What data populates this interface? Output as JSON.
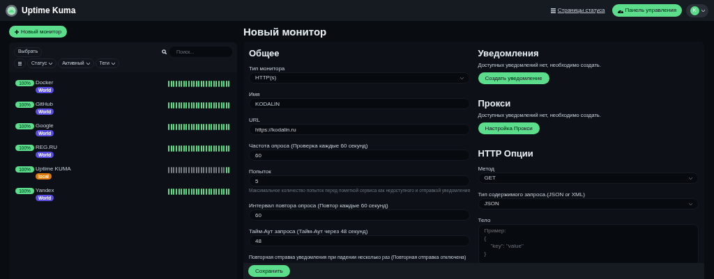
{
  "header": {
    "brand": "Uptime Kuma",
    "status_pages": "Страницы статуса",
    "dashboard": "Панель управления",
    "avatar": "K"
  },
  "sidebar": {
    "new_monitor": "Новый монитор",
    "select": "Выбрать",
    "search": {
      "placeholder": "Поиск..."
    },
    "filters": [
      {
        "label": "Статус"
      },
      {
        "label": "Активный"
      },
      {
        "label": "Теги"
      }
    ],
    "monitors": [
      {
        "uptime": "100%",
        "name": "Docker",
        "tag": {
          "label": "World",
          "color": "#5a4ee6"
        },
        "beats": [
          true,
          true,
          true,
          true,
          true,
          true,
          true,
          true,
          true,
          true,
          true,
          true,
          true,
          true,
          true,
          true,
          true,
          true,
          true,
          true,
          true,
          true,
          true,
          true,
          true
        ]
      },
      {
        "uptime": "100%",
        "name": "GitHub",
        "tag": {
          "label": "World",
          "color": "#5a4ee6"
        },
        "beats": [
          true,
          true,
          true,
          true,
          true,
          true,
          true,
          true,
          true,
          true,
          true,
          true,
          true,
          true,
          true,
          true,
          true,
          true,
          true,
          true,
          true,
          true,
          true,
          true,
          true
        ]
      },
      {
        "uptime": "100%",
        "name": "Google",
        "tag": {
          "label": "World",
          "color": "#5a4ee6"
        },
        "beats": [
          true,
          true,
          true,
          true,
          true,
          true,
          true,
          true,
          true,
          true,
          true,
          true,
          true,
          true,
          true,
          true,
          true,
          true,
          true,
          true,
          true,
          true,
          true,
          true,
          true
        ]
      },
      {
        "uptime": "100%",
        "name": "REG.RU",
        "tag": {
          "label": "World",
          "color": "#5a4ee6"
        },
        "beats": [
          true,
          true,
          true,
          true,
          true,
          true,
          true,
          true,
          true,
          true,
          true,
          true,
          true,
          true,
          true,
          true,
          true,
          true,
          true,
          true,
          true,
          true,
          true,
          true,
          true
        ]
      },
      {
        "uptime": "100%",
        "name": "Uptime KUMA",
        "tag": {
          "label": "local",
          "color": "#e07b0a"
        },
        "beats": [
          false,
          false,
          false,
          false,
          false,
          false,
          false,
          false,
          false,
          false,
          false,
          false,
          false,
          false,
          false,
          false,
          false,
          false,
          false,
          false,
          false,
          false,
          false,
          true,
          true
        ]
      },
      {
        "uptime": "100%",
        "name": "Yandex",
        "tag": {
          "label": "World",
          "color": "#5a4ee6"
        },
        "beats": [
          true,
          true,
          true,
          true,
          true,
          true,
          true,
          true,
          true,
          true,
          true,
          true,
          true,
          true,
          true,
          true,
          true,
          true,
          true,
          true,
          true,
          true,
          true,
          true,
          true
        ]
      }
    ]
  },
  "page_title": "Новый монитор",
  "general": {
    "title": "Общее",
    "fields": [
      {
        "kind": "select",
        "label": "Тип монитора",
        "value": "HTTP(s)"
      },
      {
        "kind": "input",
        "label": "Имя",
        "value": "KODALIN"
      },
      {
        "kind": "input",
        "label": "URL",
        "value": "https://kodalin.ru"
      },
      {
        "kind": "input",
        "label": "Частота опроса (Проверка каждые 60 секунд)",
        "value": "60"
      },
      {
        "kind": "input",
        "label": "Попыток",
        "value": "5",
        "hint": "Максимальное количество попыток перед пометкой сервиса как недоступного и отправкой уведомления"
      },
      {
        "kind": "input",
        "label": "Интервал повтора опроса (Повтор каждые 60 секунд)",
        "value": "60"
      },
      {
        "kind": "input",
        "label": "Тайм-Аут запроса (Тайм-Аут через 48 секунд)",
        "value": "48"
      },
      {
        "kind": "label",
        "label": "Повторная отправка уведомления при падении несколько раз (Повторная отправка отключена)"
      }
    ]
  },
  "notifications": {
    "title": "Уведомления",
    "text": "Доступных уведомлений нет, необходимо создать.",
    "button": "Создать уведомление"
  },
  "proxy": {
    "title": "Прокси",
    "text": "Доступных уведомлений нет, необходимо создать.",
    "button": "Настройка Прокси"
  },
  "http_options": {
    "title": "HTTP Опции",
    "fields": [
      {
        "kind": "select",
        "label": "Метод",
        "value": "GET"
      },
      {
        "kind": "select",
        "label": "Тип содержимого запроса.(JSON or XML)",
        "value": "JSON"
      },
      {
        "kind": "textarea",
        "label": "Тело",
        "placeholder": "Пример:\n{\n    \"key\": \"value\"\n}"
      }
    ]
  },
  "save_button": "Сохранить"
}
